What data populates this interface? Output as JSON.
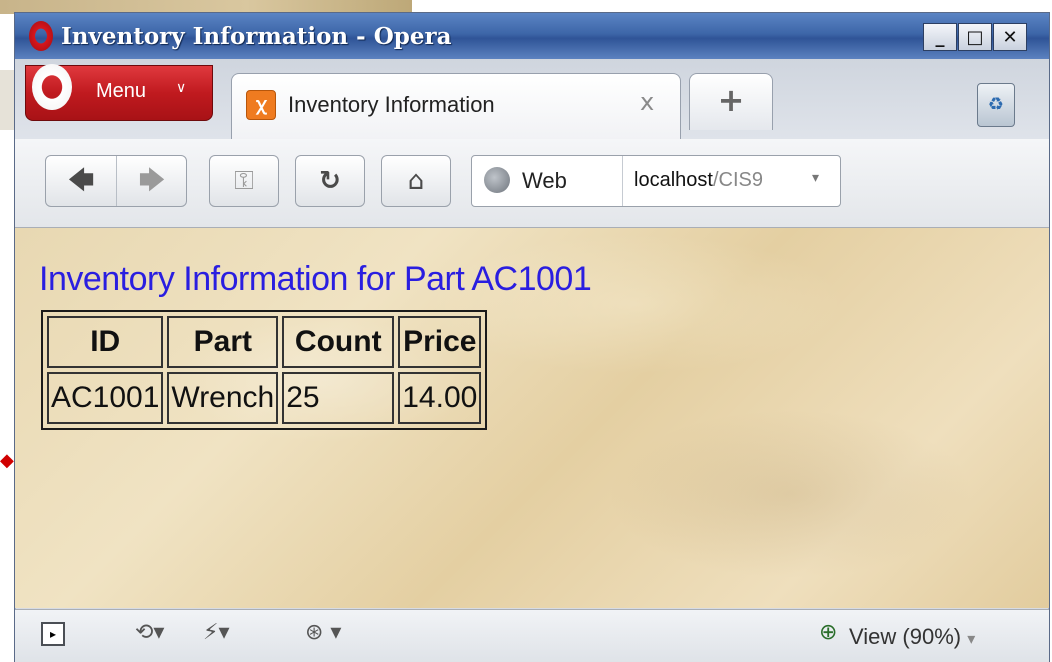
{
  "window": {
    "title": "Inventory Information - Opera"
  },
  "tabbar": {
    "menu_label": "Menu",
    "menu_chevron": "∨",
    "tabs": [
      {
        "title": "Inventory Information",
        "close": "x"
      }
    ],
    "new_tab_label": "+"
  },
  "navbar": {
    "back": "🡄",
    "forward": "🡆",
    "key": "⚿",
    "reload": "↻",
    "home": "⌂",
    "search_engine": "Web",
    "url_host": "localhost",
    "url_path": "/CIS9",
    "dropdown": "▾"
  },
  "page": {
    "heading": "Inventory Information for Part AC1001",
    "table": {
      "headers": [
        "ID",
        "Part",
        "Count",
        "Price"
      ],
      "rows": [
        [
          "AC1001",
          "Wrench",
          "25",
          "14.00"
        ]
      ]
    }
  },
  "statusbar": {
    "view_label": "View (90%)",
    "view_dropdown": "▾"
  },
  "colors": {
    "heading": "#2a1ee0",
    "titlebar": "#3d66a8",
    "menu_button": "#c01a1f",
    "tab_icon": "#ef7b20"
  }
}
